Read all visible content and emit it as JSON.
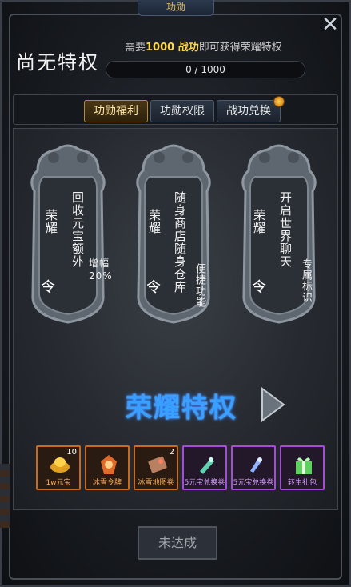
{
  "window": {
    "top_tab": "功勋",
    "title": "尚无特权",
    "close_icon": "close-icon"
  },
  "requirement": {
    "prefix": "需要",
    "amount": "1000 战功",
    "suffix": "即可获得荣耀特权"
  },
  "progress": {
    "text": "0 / 1000",
    "current": 0,
    "max": 1000
  },
  "tabs": [
    {
      "label": "功勋福利",
      "active": true
    },
    {
      "label": "功勋权限",
      "active": false
    },
    {
      "label": "战功兑换",
      "active": false,
      "badge": true
    }
  ],
  "tokens": [
    {
      "name": "荣耀",
      "desc": "回收元宝额外",
      "sub": "增幅20%",
      "seal": "令"
    },
    {
      "name": "荣耀",
      "desc": "随身商店随身仓库",
      "sub": "便捷功能",
      "seal": "令"
    },
    {
      "name": "荣耀",
      "desc": "开启世界聊天",
      "sub": "专属标识",
      "seal": "令"
    }
  ],
  "privilege_title": "荣耀特权",
  "rewards": [
    {
      "name": "1w元宝",
      "count": "10",
      "rarity": "orange",
      "color": "#e0a020"
    },
    {
      "name": "冰雪令牌",
      "count": "",
      "rarity": "orange",
      "color": "#e06a2a"
    },
    {
      "name": "冰雪地图卷",
      "count": "2",
      "rarity": "orange",
      "color": "#b88060"
    },
    {
      "name": "5元宝兑换卷",
      "count": "",
      "rarity": "purple",
      "color": "#5fd0b0"
    },
    {
      "name": "5元宝兑换卷",
      "count": "",
      "rarity": "purple",
      "color": "#8fb0ff"
    },
    {
      "name": "转生礼包",
      "count": "",
      "rarity": "purple",
      "color": "#5fd060"
    }
  ],
  "submit_button": "未达成"
}
